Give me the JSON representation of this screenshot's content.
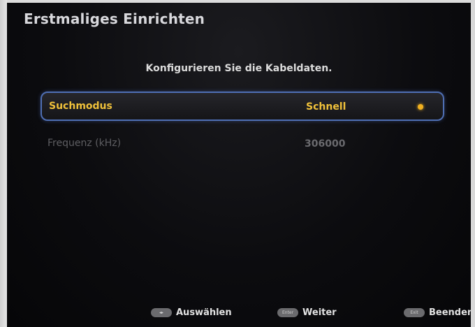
{
  "header": {
    "title": "Erstmaliges Einrichten"
  },
  "instruction": "Konfigurieren Sie die Kabeldaten.",
  "settings": [
    {
      "label": "Suchmodus",
      "value": "Schnell"
    },
    {
      "label": "Frequenz (kHz)",
      "value": "306000"
    }
  ],
  "footer": {
    "hints": [
      {
        "icon": "navigate-icon",
        "label": "Auswählen"
      },
      {
        "icon": "enter-icon",
        "label": "Weiter"
      },
      {
        "icon": "exit-icon",
        "label": "Beenden"
      }
    ]
  },
  "colors": {
    "accent": "#f0c13a",
    "focus_border": "#4f6fb4",
    "background": "#0c0c0f",
    "disabled_text": "#5e5e62"
  }
}
